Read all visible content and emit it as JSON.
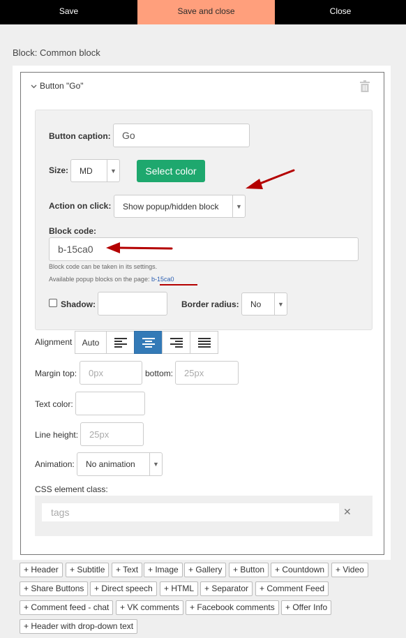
{
  "toolbar": {
    "save": "Save",
    "save_close": "Save and close",
    "close": "Close"
  },
  "block_title": "Block: Common block",
  "element": {
    "title": "Button \"Go\""
  },
  "form": {
    "caption_label": "Button caption:",
    "caption_value": "Go",
    "size_label": "Size:",
    "size_value": "MD",
    "select_color": "Select color",
    "action_label": "Action on click:",
    "action_value": "Show popup/hidden block",
    "block_code_label": "Block code:",
    "block_code_value": "b-15ca0",
    "hint_1": "Block code can be taken in its settings.",
    "hint_2": "Available popup blocks on the page:",
    "hint_link": "b-15ca0",
    "shadow_label": "Shadow:",
    "border_radius_label": "Border radius:",
    "border_radius_value": "No",
    "alignment_label": "Alignment",
    "alignment_auto": "Auto",
    "margin_top_label": "Margin top:",
    "margin_top_placeholder": "0px",
    "bottom_label": "bottom:",
    "bottom_placeholder": "25px",
    "text_color_label": "Text color:",
    "line_height_label": "Line height:",
    "line_height_placeholder": "25px",
    "animation_label": "Animation:",
    "animation_value": "No animation",
    "css_class_label": "CSS element class:",
    "tags_placeholder": "tags"
  },
  "add_buttons": [
    "+ Header",
    "+ Subtitle",
    "+ Text",
    "+ Image",
    "+ Gallery",
    "+ Button",
    "+ Countdown",
    "+ Video",
    "+ Share Buttons",
    "+ Direct speech",
    "+ HTML",
    "+ Separator",
    "+ Comment Feed",
    "+ Comment feed - chat",
    "+ VK comments",
    "+ Facebook comments",
    "+ Offer Info",
    "+ Header with drop-down text"
  ],
  "colors": {
    "accent_orange": "#ff9f7c",
    "green": "#1ea86e",
    "active_blue": "#337ab7",
    "arrow_red": "#b40000"
  }
}
